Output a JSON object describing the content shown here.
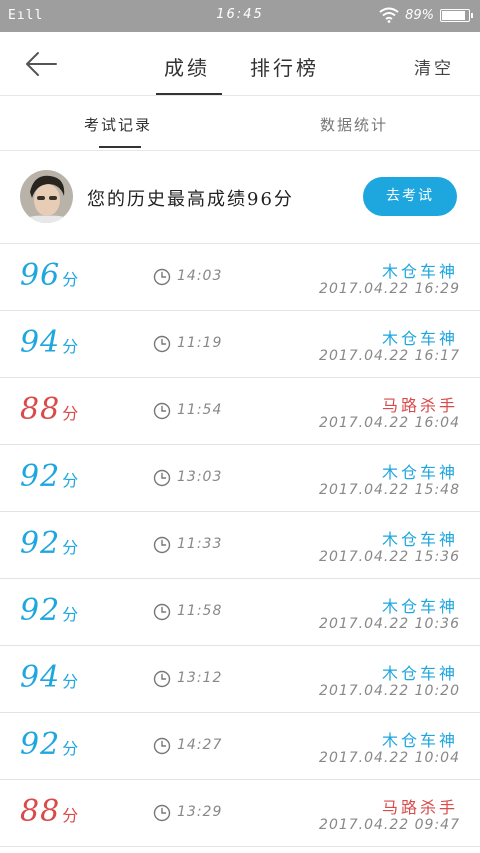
{
  "status_bar": {
    "signal": "E",
    "time": "16:45",
    "battery": "89%",
    "battery_level": 0.89
  },
  "nav": {
    "tabs": [
      "成绩",
      "排行榜"
    ],
    "clear_label": "清空"
  },
  "sub_tabs": [
    "考试记录",
    "数据统计"
  ],
  "profile": {
    "best_score_text": "您的历史最高成绩96分",
    "go_exam_label": "去考试"
  },
  "colors": {
    "accent": "#1ea6de",
    "fail": "#d94a4a"
  },
  "records": [
    {
      "score": "96",
      "unit": "分",
      "duration": "14:03",
      "name": "木仓车神",
      "date": "2017.04.22  16:29",
      "status": "pass"
    },
    {
      "score": "94",
      "unit": "分",
      "duration": "11:19",
      "name": "木仓车神",
      "date": "2017.04.22  16:17",
      "status": "pass"
    },
    {
      "score": "88",
      "unit": "分",
      "duration": "11:54",
      "name": "马路杀手",
      "date": "2017.04.22  16:04",
      "status": "fail"
    },
    {
      "score": "92",
      "unit": "分",
      "duration": "13:03",
      "name": "木仓车神",
      "date": "2017.04.22  15:48",
      "status": "pass"
    },
    {
      "score": "92",
      "unit": "分",
      "duration": "11:33",
      "name": "木仓车神",
      "date": "2017.04.22  15:36",
      "status": "pass"
    },
    {
      "score": "92",
      "unit": "分",
      "duration": "11:58",
      "name": "木仓车神",
      "date": "2017.04.22  10:36",
      "status": "pass"
    },
    {
      "score": "94",
      "unit": "分",
      "duration": "13:12",
      "name": "木仓车神",
      "date": "2017.04.22  10:20",
      "status": "pass"
    },
    {
      "score": "92",
      "unit": "分",
      "duration": "14:27",
      "name": "木仓车神",
      "date": "2017.04.22  10:04",
      "status": "pass"
    },
    {
      "score": "88",
      "unit": "分",
      "duration": "13:29",
      "name": "马路杀手",
      "date": "2017.04.22  09:47",
      "status": "fail"
    }
  ]
}
